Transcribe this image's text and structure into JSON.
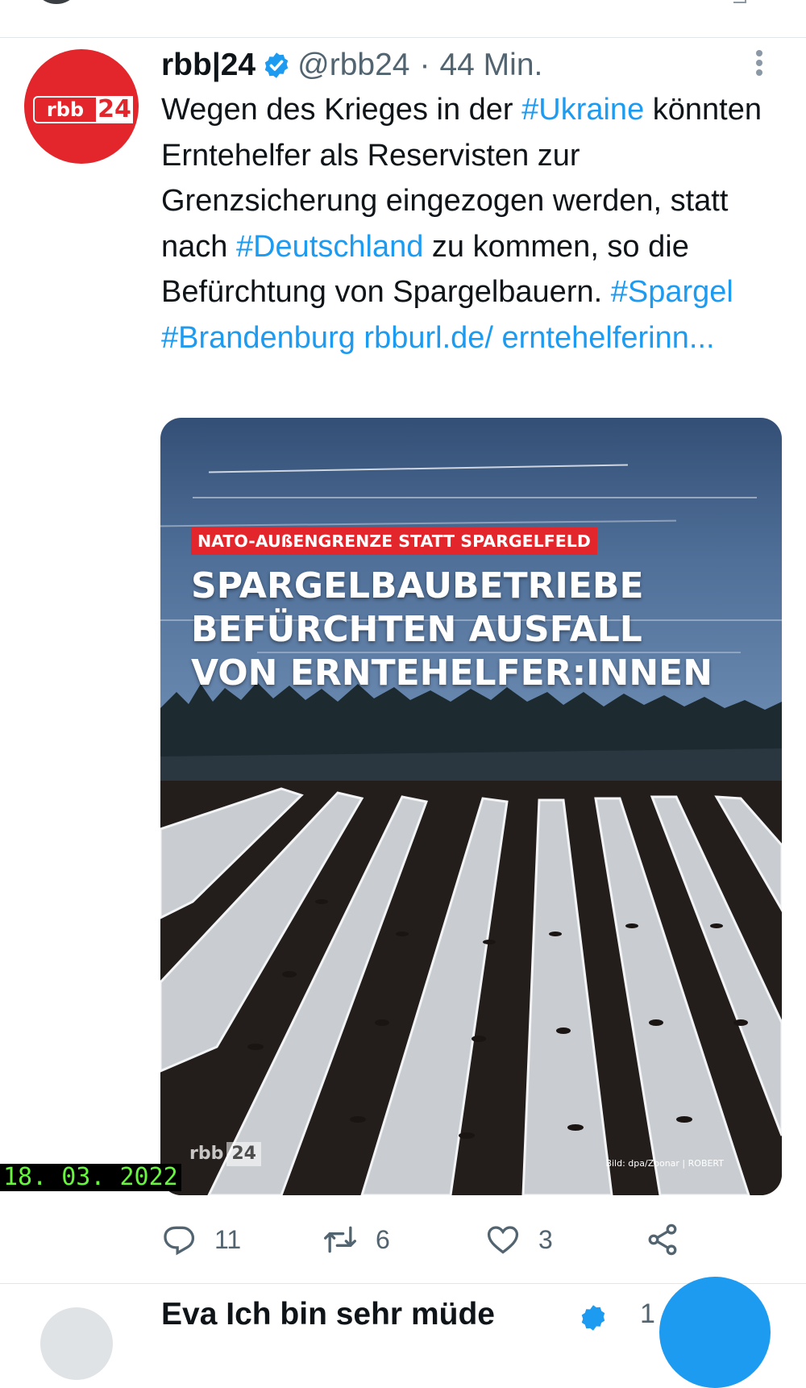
{
  "tweet": {
    "author": "rbb|24",
    "handle": "@rbb24",
    "separator": "·",
    "time": "44 Min.",
    "avatar_logo_left": "rbb",
    "avatar_logo_right": "24",
    "text_parts": [
      {
        "t": "Wegen des Krieges in der ",
        "link": false
      },
      {
        "t": "#Ukraine",
        "link": true
      },
      {
        "t": " könnten Erntehelfer als Reservisten zur Grenzsicherung eingezogen werden, statt nach ",
        "link": false
      },
      {
        "t": "#Deutschland",
        "link": true
      },
      {
        "t": " zu kommen, so die Befürchtung von Spargelbauern. ",
        "link": false
      },
      {
        "t": "#Spargel",
        "link": true
      },
      {
        "t": " ",
        "link": false
      },
      {
        "t": "#Brandenburg",
        "link": true
      },
      {
        "t": " ",
        "link": false
      },
      {
        "t": "rbburl.de/ erntehelferinn...",
        "link": true
      }
    ],
    "media": {
      "kicker": "NATO-AUßENGRENZE STATT SPARGELFELD",
      "headline": "SPARGELBAUBETRIEBE\nBEFÜRCHTEN AUSFALL\nVON ERNTEHELFER:INNEN",
      "watermark_left": "rbb",
      "watermark_right": "24",
      "credit": "Bild: dpa/Zoonar | ROBERT"
    },
    "actions": {
      "reply_count": "11",
      "retweet_count": "6",
      "like_count": "3"
    }
  },
  "date_stamp": "18. 03. 2022",
  "next_tweet": {
    "name": "Eva Ich bin sehr müde",
    "count": "1"
  },
  "colors": {
    "link": "#1d9bf0",
    "brand_red": "#e2262b",
    "muted": "#536471",
    "stamp_green": "#67f53d"
  },
  "icons": {
    "verified": "verified-badge-icon",
    "more": "more-dots-icon",
    "reply": "reply-icon",
    "retweet": "retweet-icon",
    "like": "heart-icon",
    "share": "share-icon"
  }
}
